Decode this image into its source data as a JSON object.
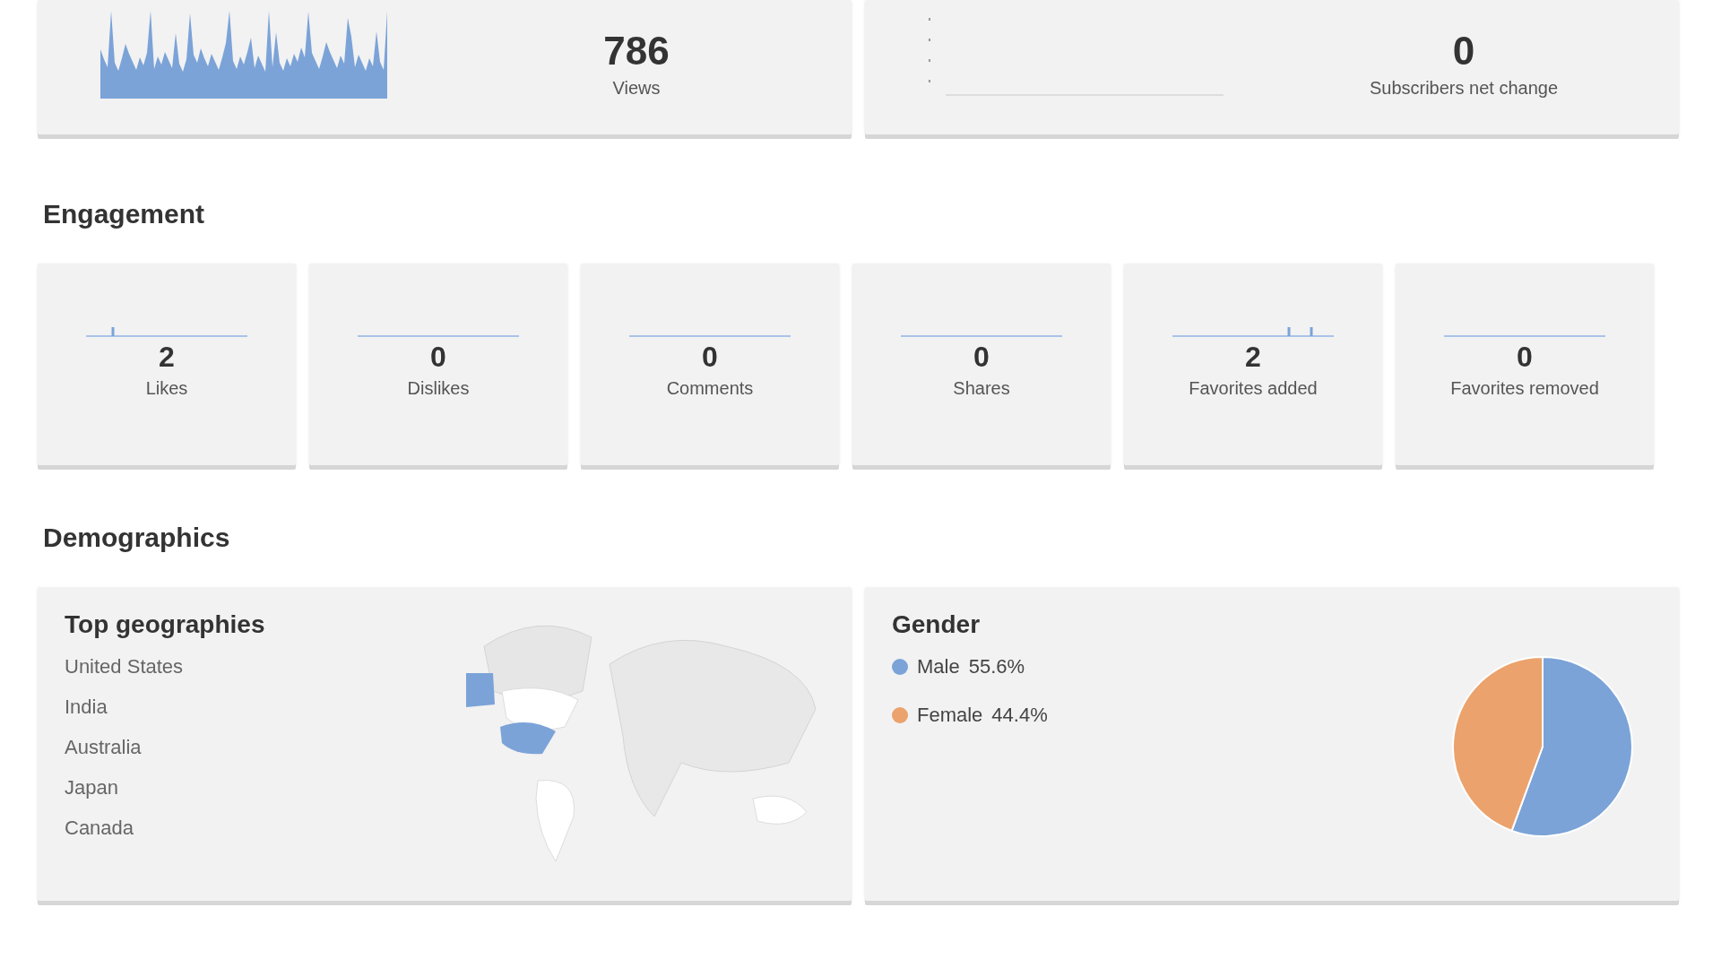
{
  "overview": [
    {
      "kind": "views",
      "value": "786",
      "label": "Views"
    },
    {
      "kind": "subscribers",
      "value": "0",
      "label": "Subscribers net change"
    }
  ],
  "engagement": {
    "title": "Engagement",
    "cards": [
      {
        "value": "2",
        "label": "Likes"
      },
      {
        "value": "0",
        "label": "Dislikes"
      },
      {
        "value": "0",
        "label": "Comments"
      },
      {
        "value": "0",
        "label": "Shares"
      },
      {
        "value": "2",
        "label": "Favorites added"
      },
      {
        "value": "0",
        "label": "Favorites removed"
      }
    ]
  },
  "demographics": {
    "title": "Demographics",
    "geographies": {
      "title": "Top geographies",
      "items": [
        "United States",
        "India",
        "Australia",
        "Japan",
        "Canada"
      ]
    },
    "gender": {
      "title": "Gender",
      "legend": [
        {
          "label": "Male",
          "value": "55.6%",
          "color": "#7ba3d8"
        },
        {
          "label": "Female",
          "value": "44.4%",
          "color": "#eba26c"
        }
      ]
    }
  }
}
